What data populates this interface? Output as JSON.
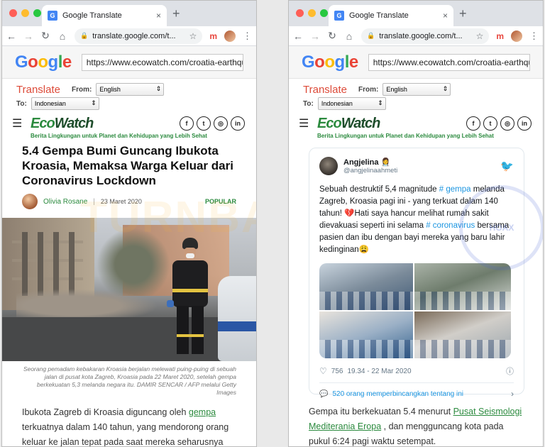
{
  "browser": {
    "tab_title": "Google Translate",
    "tab_close": "×",
    "new_tab": "+",
    "address": "translate.google.com/t...",
    "ext_label": "m"
  },
  "google": {
    "logo": "Google",
    "url_value": "https://www.ecowatch.com/croatia-earthquake-c"
  },
  "translate": {
    "title": "Translate",
    "from_label": "From:",
    "from_value": "English",
    "to_label": "To:",
    "to_value": "Indonesian"
  },
  "site": {
    "logo_a": "Eco",
    "logo_b": "Watch",
    "tagline": "Berita Lingkungan untuk Planet dan Kehidupan yang Lebih Sehat",
    "social": [
      "f",
      "t",
      "◎",
      "in"
    ]
  },
  "left": {
    "headline": "5.4 Gempa Bumi Guncang Ibukota Kroasia, Memaksa Warga Keluar dari Coronavirus Lockdown",
    "author": "Olivia Rosane",
    "separator": "|",
    "date": "23 Maret 2020",
    "badge": "POPULAR",
    "caption": "Seorang pemadam kebakaran Kroasia berjalan melewati puing-puing di sebuah jalan di pusat kota Zagreb, Kroasia pada 22 Maret 2020, setelah gempa berkekuatan 5,3 melanda negara itu. DAMIR SENCAR / AFP melalui Getty Images",
    "body_pre": "Ibukota Zagreb di Kroasia diguncang oleh ",
    "body_link": "gempa",
    "body_post": " terkuatnya dalam 140 tahun, yang mendorong orang keluar ke jalan tepat pada saat mereka seharusnya tinggal di dalam rumah untuk memerangi penyebaran"
  },
  "tweet": {
    "name": "Angjelina 👩‍⚕️",
    "handle": "@angjelinaahmeti",
    "text_1": "Sebuah destruktif 5,4 magnitude ",
    "tag_1": "# gempa",
    "text_2": " melanda Zagreb, Kroasia pagi ini - yang terkuat dalam 140 tahun! 💔Hati saya hancur melihat rumah sakit dievakuasi seperti ini selama ",
    "tag_2": "# coronavirus",
    "text_3": " bersama pasien dan ibu dengan bayi mereka yang baru lahir kedinginan😩",
    "likes": "756",
    "time": "19.34 - 22 Mar 2020",
    "replies": "520 orang memperbincangkan tentang ini"
  },
  "right": {
    "body_pre": "Gempa itu berkekuatan 5.4 menurut ",
    "body_link": "Pusat Seismologi Mediterania Eropa",
    "body_post": " , dan mengguncang kota pada pukul 6:24 pagi waktu setempat."
  },
  "watermark": {
    "left_text": "TURNBACKHOAX",
    "seal_text": "HOAX"
  }
}
